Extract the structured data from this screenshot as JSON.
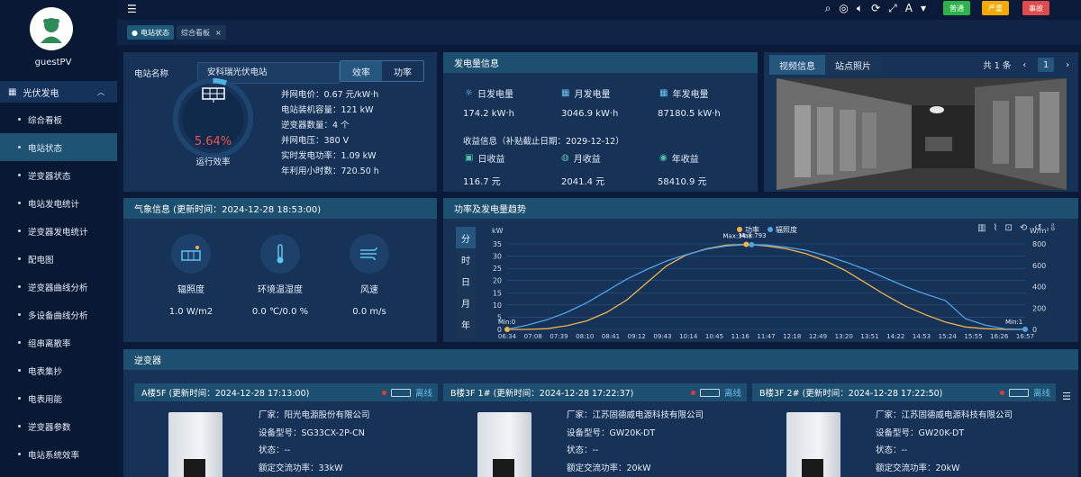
{
  "user": {
    "name": "guestPV"
  },
  "sidebar": {
    "group": "光伏发电",
    "items": [
      {
        "label": "综合看板"
      },
      {
        "label": "电站状态"
      },
      {
        "label": "逆变器状态"
      },
      {
        "label": "电站发电统计"
      },
      {
        "label": "逆变器发电统计"
      },
      {
        "label": "配电图"
      },
      {
        "label": "逆变器曲线分析"
      },
      {
        "label": "多设备曲线分析"
      },
      {
        "label": "组串离散率"
      },
      {
        "label": "电表集抄"
      },
      {
        "label": "电表用能"
      },
      {
        "label": "逆变器参数"
      },
      {
        "label": "电站系统效率"
      }
    ]
  },
  "topbar": {
    "badges": [
      {
        "label": "普通",
        "color": "#2db34a"
      },
      {
        "label": "严重",
        "color": "#f2a900"
      },
      {
        "label": "事故",
        "color": "#e04b4b"
      }
    ]
  },
  "tabs": [
    {
      "label": "电站状态"
    },
    {
      "label": "综合看板"
    }
  ],
  "station": {
    "name_label": "电站名称",
    "name_value": "安科瑞光伏电站",
    "toggle": [
      "效率",
      "功率"
    ],
    "efficiency": "5.64%",
    "efficiency_value": 5.64,
    "efficiency_label": "运行效率",
    "stats": [
      "并网电价：0.67 元/kW·h",
      "电站装机容量：121 kW",
      "逆变器数量：4 个",
      "并网电压：380 V",
      "实时发电功率：1.09 kW",
      "年利用小时数：720.50 h"
    ]
  },
  "generation": {
    "title": "发电量信息",
    "items": [
      {
        "label": "日发电量",
        "value": "174.2 kW·h"
      },
      {
        "label": "月发电量",
        "value": "3046.9 kW·h"
      },
      {
        "label": "年发电量",
        "value": "87180.5 kW·h"
      }
    ],
    "income_title": "收益信息（补贴截止日期：2029-12-12）",
    "income": [
      {
        "label": "日收益",
        "value": "116.7 元"
      },
      {
        "label": "月收益",
        "value": "2041.4 元"
      },
      {
        "label": "年收益",
        "value": "58410.9 元"
      }
    ]
  },
  "video": {
    "tabs": [
      "视频信息",
      "站点照片"
    ],
    "total": "共 1 条",
    "page": "1"
  },
  "weather": {
    "title": "气象信息 (更新时间：2024-12-28 18:53:00)",
    "items": [
      {
        "label": "辐照度",
        "value": "1.0 W/m2"
      },
      {
        "label": "环境温湿度",
        "value": "0.0 ℃/0.0 %"
      },
      {
        "label": "风速",
        "value": "0.0 m/s"
      }
    ]
  },
  "trend": {
    "title": "功率及发电量趋势",
    "side_tabs": [
      "分",
      "时",
      "日",
      "月",
      "年"
    ]
  },
  "chart_data": {
    "type": "line",
    "ylabel_left": "kW",
    "ylabel_right": "W/m²",
    "ylim_left": [
      0,
      35
    ],
    "ylim_right": [
      0,
      800
    ],
    "yticks_left": [
      "35",
      "30",
      "25",
      "20",
      "15",
      "10",
      "5",
      "0"
    ],
    "yticks_right": [
      "800",
      "600",
      "400",
      "200",
      "0"
    ],
    "x_ticks": [
      "06:34",
      "07:08",
      "07:39",
      "08:10",
      "08:41",
      "09:12",
      "09:43",
      "10:14",
      "10:45",
      "11:16",
      "11:47",
      "12:18",
      "12:49",
      "13:20",
      "13:51",
      "14:22",
      "14:53",
      "15:24",
      "15:55",
      "16:26",
      "16:57"
    ],
    "legend": [
      "功率",
      "辐照度"
    ],
    "annotations": {
      "max_power": "Max:34.8",
      "max_irr": "Max:793",
      "min_power": "Min:0",
      "min_irr": "Min:1"
    },
    "series": [
      {
        "name": "功率",
        "color": "#f2b44a",
        "axis": "left",
        "values": [
          0,
          0,
          0.3,
          1.5,
          3.5,
          7,
          12,
          19,
          26,
          30.5,
          33,
          34.5,
          34.8,
          34.2,
          33,
          31,
          28,
          24,
          19,
          14,
          9.5,
          6,
          3,
          1,
          0.3,
          0,
          0
        ]
      },
      {
        "name": "辐照度",
        "color": "#4fa3e8",
        "axis": "right",
        "values": [
          1,
          40,
          90,
          160,
          250,
          360,
          470,
          560,
          640,
          700,
          750,
          780,
          793,
          790,
          770,
          740,
          690,
          630,
          560,
          480,
          400,
          330,
          270,
          100,
          40,
          5,
          1
        ]
      }
    ]
  },
  "inverters": {
    "title": "逆变器",
    "status_label": "离线",
    "list": [
      {
        "header": "A楼5F (更新时间：2024-12-28 17:13:00)",
        "vendor": "厂家：阳光电源股份有限公司",
        "model": "设备型号：SG33CX-2P-CN",
        "state": "状态：--",
        "rated": "额定交流功率：33kW"
      },
      {
        "header": "B楼3F 1# (更新时间：2024-12-28 17:22:37)",
        "vendor": "厂家：江苏固德威电源科技有限公司",
        "model": "设备型号：GW20K-DT",
        "state": "状态：--",
        "rated": "额定交流功率：20kW"
      },
      {
        "header": "B楼3F 2# (更新时间：2024-12-28 17:22:50)",
        "vendor": "厂家：江苏固德威电源科技有限公司",
        "model": "设备型号：GW20K-DT",
        "state": "状态：--",
        "rated": "额定交流功率：20kW"
      }
    ]
  }
}
